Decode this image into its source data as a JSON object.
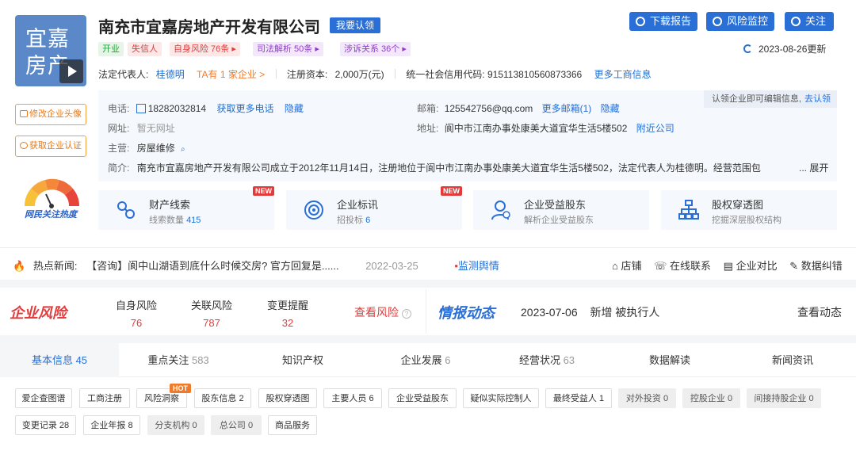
{
  "company": {
    "logo_line1": "宜嘉",
    "logo_line2": "房产",
    "name": "南充市宜嘉房地产开发有限公司",
    "claim_label": "我要认领"
  },
  "side_buttons": {
    "edit_avatar": "修改企业头像",
    "get_cert": "获取企业认证",
    "gauge_label": "网民关注热度"
  },
  "top_actions": {
    "download": "下载报告",
    "monitor": "风险监控",
    "follow": "关注",
    "updated": "2023-08-26更新"
  },
  "tags": {
    "open": "开业",
    "dishonest": "失信人",
    "self_risk": "自身风险 76条 ▸",
    "judicial": "司法解析 50条 ▸",
    "lawsuit": "涉诉关系 36个 ▸"
  },
  "basic": {
    "legal_rep_label": "法定代表人:",
    "legal_rep": "桂德明",
    "ta_companies": "TA有 1 家企业 >",
    "capital_label": "注册资本:",
    "capital": "2,000万(元)",
    "credit_code_label": "统一社会信用代码:",
    "credit_code": "915113810560873366",
    "more_info": "更多工商信息"
  },
  "contact": {
    "phone_label": "电话:",
    "phone": "18282032814",
    "more_phone": "获取更多电话",
    "hide1": "隐藏",
    "email_label": "邮箱:",
    "email": "125542756@qq.com",
    "more_email": "更多邮箱(1)",
    "hide2": "隐藏",
    "website_label": "网址:",
    "website": "暂无网址",
    "address_label": "地址:",
    "address": "阆中市江南办事处康美大道宜华生活5楼502",
    "nearby": "附近公司",
    "main_label": "主营:",
    "main": "房屋维修",
    "intro_label": "简介:",
    "intro": "南充市宜嘉房地产开发有限公司成立于2012年11月14日，注册地位于阆中市江南办事处康美大道宜华生活5楼502，法定代表人为桂德明。经营范围包",
    "expand": "... 展开",
    "edit_tip": "认领企业即可编辑信息,",
    "edit_link": "去认领"
  },
  "cards": [
    {
      "title": "财产线索",
      "sub": "线索数量",
      "num": "415",
      "badge": "NEW"
    },
    {
      "title": "企业标讯",
      "sub": "招投标",
      "num": "6",
      "badge": "NEW"
    },
    {
      "title": "企业受益股东",
      "sub": "解析企业受益股东",
      "num": "",
      "badge": ""
    },
    {
      "title": "股权穿透图",
      "sub": "挖掘深层股权结构",
      "num": "",
      "badge": ""
    }
  ],
  "news": {
    "label": "热点新闻:",
    "headline": "【咨询】阆中山湖语到底什么时候交房? 官方回复是......",
    "date": "2022-03-25",
    "monitor": "监测舆情",
    "tools": [
      "店铺",
      "在线联系",
      "企业对比",
      "数据纠错"
    ]
  },
  "risk": {
    "logo": "企业风险",
    "items": [
      {
        "label": "自身风险",
        "value": "76"
      },
      {
        "label": "关联风险",
        "value": "787"
      },
      {
        "label": "变更提醒",
        "value": "32"
      }
    ],
    "view": "查看风险",
    "intel_logo": "情报动态",
    "intel_date": "2023-07-06",
    "intel_text": "新增 被执行人",
    "view_intel": "查看动态"
  },
  "tabs": [
    {
      "label": "基本信息",
      "count": "45"
    },
    {
      "label": "重点关注",
      "count": "583"
    },
    {
      "label": "知识产权",
      "count": ""
    },
    {
      "label": "企业发展",
      "count": "6"
    },
    {
      "label": "经营状况",
      "count": "63"
    },
    {
      "label": "数据解读",
      "count": ""
    },
    {
      "label": "新闻资讯",
      "count": ""
    }
  ],
  "sub_items": {
    "row1": [
      "爱企查图谱",
      "工商注册",
      "风险洞察",
      "股东信息 2",
      "股权穿透图",
      "主要人员 6",
      "企业受益股东",
      "疑似实际控制人",
      "最终受益人 1",
      "对外投资 0",
      "控股企业 0",
      "间接持股企业 0"
    ],
    "row2": [
      "变更记录 28",
      "企业年报 8",
      "分支机构 0",
      "总公司 0",
      "商品服务"
    ],
    "hot": "HOT"
  },
  "colors": {
    "brand": "#2a6fd6",
    "risk_red": "#e33b3b",
    "orange": "#e87a1a"
  }
}
